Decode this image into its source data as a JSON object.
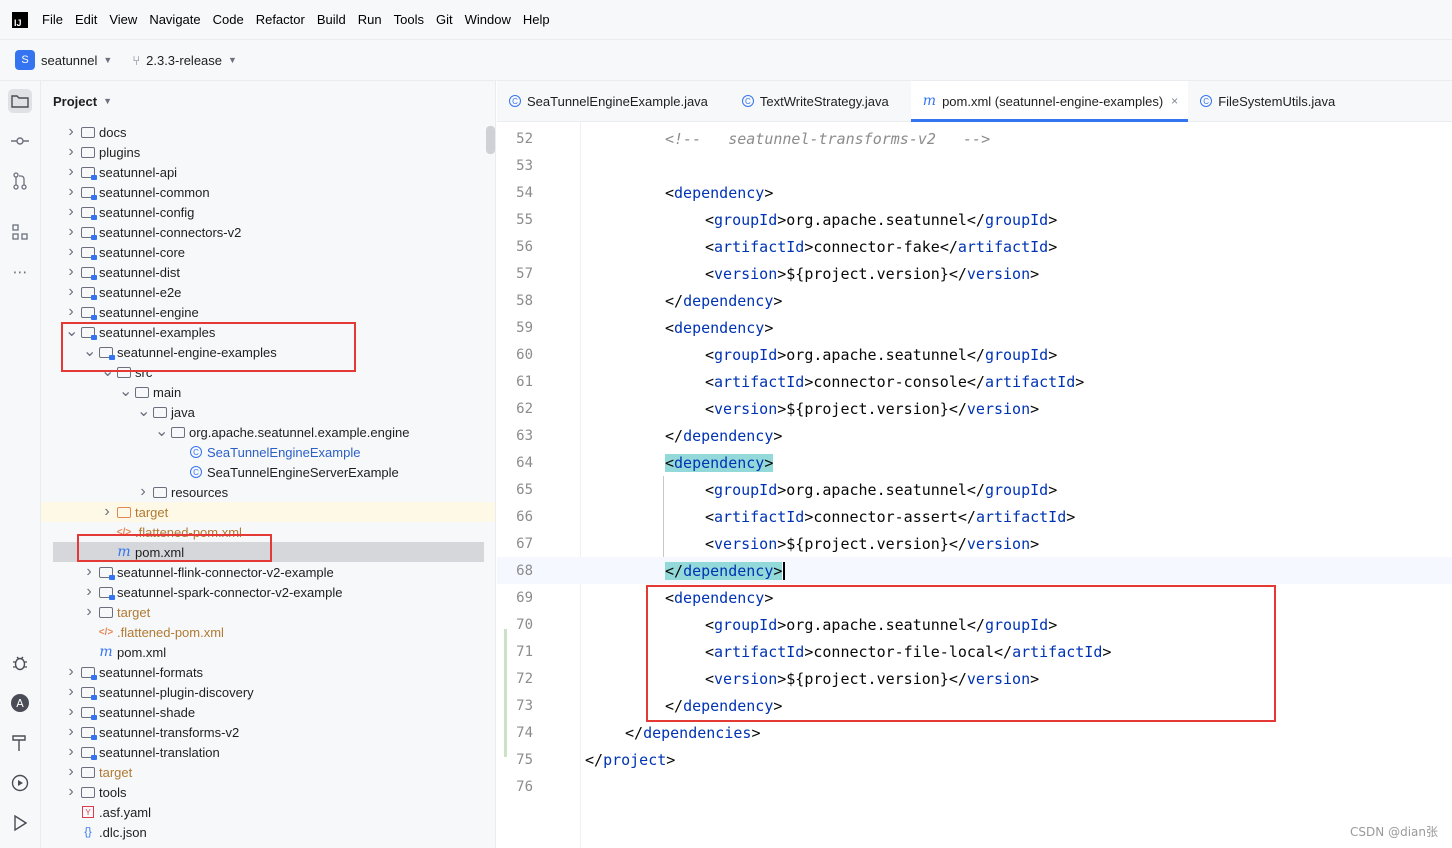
{
  "menubar": {
    "items": [
      "File",
      "Edit",
      "View",
      "Navigate",
      "Code",
      "Refactor",
      "Build",
      "Run",
      "Tools",
      "Git",
      "Window",
      "Help"
    ]
  },
  "toolbar": {
    "project_badge": "S",
    "project_name": "seatunnel",
    "branch": "2.3.3-release"
  },
  "stripe": {
    "icons": [
      "folder-icon",
      "commit-icon",
      "pull-requests-icon",
      "structure-icon",
      "more-icon",
      "debug-icon",
      "ai-assistant-icon",
      "build-icon",
      "services-icon",
      "run-icon"
    ]
  },
  "project_panel": {
    "title": "Project",
    "tree": [
      {
        "label": "docs",
        "indent": 0,
        "arrow": ">",
        "icon": "folder",
        "style": "dark"
      },
      {
        "label": "plugins",
        "indent": 0,
        "arrow": ">",
        "icon": "folder",
        "style": "dark"
      },
      {
        "label": "seatunnel-api",
        "indent": 0,
        "arrow": ">",
        "icon": "module",
        "style": "dark"
      },
      {
        "label": "seatunnel-common",
        "indent": 0,
        "arrow": ">",
        "icon": "module",
        "style": "dark"
      },
      {
        "label": "seatunnel-config",
        "indent": 0,
        "arrow": ">",
        "icon": "module",
        "style": "dark"
      },
      {
        "label": "seatunnel-connectors-v2",
        "indent": 0,
        "arrow": ">",
        "icon": "module",
        "style": "dark"
      },
      {
        "label": "seatunnel-core",
        "indent": 0,
        "arrow": ">",
        "icon": "module",
        "style": "dark"
      },
      {
        "label": "seatunnel-dist",
        "indent": 0,
        "arrow": ">",
        "icon": "module",
        "style": "dark"
      },
      {
        "label": "seatunnel-e2e",
        "indent": 0,
        "arrow": ">",
        "icon": "module",
        "style": "dark"
      },
      {
        "label": "seatunnel-engine",
        "indent": 0,
        "arrow": ">",
        "icon": "module",
        "style": "dark"
      },
      {
        "label": "seatunnel-examples",
        "indent": 0,
        "arrow": "v",
        "icon": "module",
        "style": "dark"
      },
      {
        "label": "seatunnel-engine-examples",
        "indent": 1,
        "arrow": "v",
        "icon": "module",
        "style": "dark"
      },
      {
        "label": "src",
        "indent": 2,
        "arrow": "v",
        "icon": "folder",
        "style": "dark"
      },
      {
        "label": "main",
        "indent": 3,
        "arrow": "v",
        "icon": "folder",
        "style": "dark"
      },
      {
        "label": "java",
        "indent": 4,
        "arrow": "v",
        "icon": "folder",
        "style": "dark"
      },
      {
        "label": "org.apache.seatunnel.example.engine",
        "indent": 5,
        "arrow": "v",
        "icon": "package",
        "style": "dark"
      },
      {
        "label": "SeaTunnelEngineExample",
        "indent": 6,
        "arrow": "",
        "icon": "class",
        "style": "blue"
      },
      {
        "label": "SeaTunnelEngineServerExample",
        "indent": 6,
        "arrow": "",
        "icon": "class",
        "style": "dark"
      },
      {
        "label": "resources",
        "indent": 4,
        "arrow": ">",
        "icon": "resources",
        "style": "dark"
      },
      {
        "label": "target",
        "indent": 2,
        "arrow": ">",
        "icon": "orange",
        "style": "orange"
      },
      {
        "label": ".flattened-pom.xml",
        "indent": 2,
        "arrow": "",
        "icon": "xml",
        "style": "orange"
      },
      {
        "label": "pom.xml",
        "indent": 2,
        "arrow": "",
        "icon": "m",
        "style": "dark"
      },
      {
        "label": "seatunnel-flink-connector-v2-example",
        "indent": 1,
        "arrow": ">",
        "icon": "module",
        "style": "dark"
      },
      {
        "label": "seatunnel-spark-connector-v2-example",
        "indent": 1,
        "arrow": ">",
        "icon": "module",
        "style": "dark"
      },
      {
        "label": "target",
        "indent": 1,
        "arrow": ">",
        "icon": "folder",
        "style": "orange"
      },
      {
        "label": ".flattened-pom.xml",
        "indent": 1,
        "arrow": "",
        "icon": "xml",
        "style": "orange"
      },
      {
        "label": "pom.xml",
        "indent": 1,
        "arrow": "",
        "icon": "m",
        "style": "dark"
      },
      {
        "label": "seatunnel-formats",
        "indent": 0,
        "arrow": ">",
        "icon": "module",
        "style": "dark"
      },
      {
        "label": "seatunnel-plugin-discovery",
        "indent": 0,
        "arrow": ">",
        "icon": "module",
        "style": "dark"
      },
      {
        "label": "seatunnel-shade",
        "indent": 0,
        "arrow": ">",
        "icon": "module",
        "style": "dark"
      },
      {
        "label": "seatunnel-transforms-v2",
        "indent": 0,
        "arrow": ">",
        "icon": "module",
        "style": "dark"
      },
      {
        "label": "seatunnel-translation",
        "indent": 0,
        "arrow": ">",
        "icon": "module",
        "style": "dark"
      },
      {
        "label": "target",
        "indent": 0,
        "arrow": ">",
        "icon": "folder",
        "style": "orange"
      },
      {
        "label": "tools",
        "indent": 0,
        "arrow": ">",
        "icon": "folder",
        "style": "dark"
      },
      {
        "label": ".asf.yaml",
        "indent": 0,
        "arrow": "",
        "icon": "yaml",
        "style": "dark"
      },
      {
        "label": ".dlc.json",
        "indent": 0,
        "arrow": "",
        "icon": "json",
        "style": "dark"
      }
    ]
  },
  "editor": {
    "tabs": [
      {
        "label": "SeaTunnelEngineExample.java",
        "icon": "class",
        "active": false
      },
      {
        "label": "TextWriteStrategy.java",
        "icon": "class",
        "active": false
      },
      {
        "label": "pom.xml (seatunnel-engine-examples)",
        "icon": "m",
        "active": true
      },
      {
        "label": "FileSystemUtils.java",
        "icon": "class",
        "active": false
      }
    ],
    "lines": [
      {
        "n": "52",
        "indent": 2,
        "kind": "comment",
        "text": "<!--   seatunnel-transforms-v2   -->"
      },
      {
        "n": "53",
        "indent": 0,
        "kind": "blank",
        "text": ""
      },
      {
        "n": "54",
        "indent": 2,
        "kind": "open",
        "tag": "dependency"
      },
      {
        "n": "55",
        "indent": 3,
        "kind": "elem",
        "tag": "groupId",
        "value": "org.apache.seatunnel"
      },
      {
        "n": "56",
        "indent": 3,
        "kind": "elem",
        "tag": "artifactId",
        "value": "connector-fake"
      },
      {
        "n": "57",
        "indent": 3,
        "kind": "elem",
        "tag": "version",
        "value": "${project.version}"
      },
      {
        "n": "58",
        "indent": 2,
        "kind": "close",
        "tag": "dependency"
      },
      {
        "n": "59",
        "indent": 2,
        "kind": "open",
        "tag": "dependency"
      },
      {
        "n": "60",
        "indent": 3,
        "kind": "elem",
        "tag": "groupId",
        "value": "org.apache.seatunnel"
      },
      {
        "n": "61",
        "indent": 3,
        "kind": "elem",
        "tag": "artifactId",
        "value": "connector-console"
      },
      {
        "n": "62",
        "indent": 3,
        "kind": "elem",
        "tag": "version",
        "value": "${project.version}"
      },
      {
        "n": "63",
        "indent": 2,
        "kind": "close",
        "tag": "dependency"
      },
      {
        "n": "64",
        "indent": 2,
        "kind": "open",
        "tag": "dependency",
        "highlight": true
      },
      {
        "n": "65",
        "indent": 3,
        "kind": "elem",
        "tag": "groupId",
        "value": "org.apache.seatunnel"
      },
      {
        "n": "66",
        "indent": 3,
        "kind": "elem",
        "tag": "artifactId",
        "value": "connector-assert"
      },
      {
        "n": "67",
        "indent": 3,
        "kind": "elem",
        "tag": "version",
        "value": "${project.version}"
      },
      {
        "n": "68",
        "indent": 2,
        "kind": "close",
        "tag": "dependency",
        "highlight": true,
        "current": true
      },
      {
        "n": "69",
        "indent": 2,
        "kind": "open",
        "tag": "dependency"
      },
      {
        "n": "70",
        "indent": 3,
        "kind": "elem",
        "tag": "groupId",
        "value": "org.apache.seatunnel"
      },
      {
        "n": "71",
        "indent": 3,
        "kind": "elem",
        "tag": "artifactId",
        "value": "connector-file-local"
      },
      {
        "n": "72",
        "indent": 3,
        "kind": "elem",
        "tag": "version",
        "value": "${project.version}"
      },
      {
        "n": "73",
        "indent": 2,
        "kind": "close",
        "tag": "dependency"
      },
      {
        "n": "74",
        "indent": 1,
        "kind": "close",
        "tag": "dependencies"
      },
      {
        "n": "75",
        "indent": 0,
        "kind": "close",
        "tag": "project"
      },
      {
        "n": "76",
        "indent": 0,
        "kind": "blank",
        "text": ""
      }
    ]
  },
  "watermark": "CSDN @dian张",
  "colors": {
    "accent": "#3574f0",
    "tag": "#0033b3",
    "annotation": "#e53935",
    "brace_highlight": "#93d9d9"
  }
}
